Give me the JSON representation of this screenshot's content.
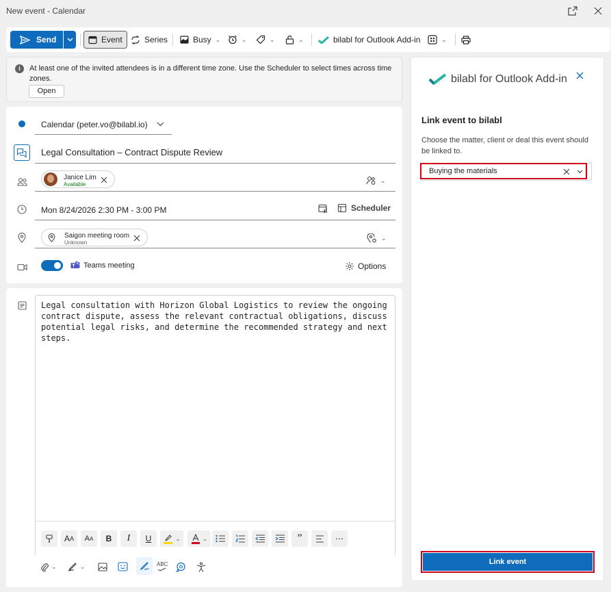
{
  "window": {
    "title": "New event - Calendar"
  },
  "toolbar": {
    "send_label": "Send",
    "event_label": "Event",
    "series_label": "Series",
    "busy_label": "Busy",
    "addin_label": "bilabl for Outlook Add-in"
  },
  "infobar": {
    "message": "At least one of the invited attendees is in a different time zone. Use the Scheduler to select times across time zones.",
    "open_label": "Open"
  },
  "form": {
    "calendar": "Calendar (peter.vo@bilabl.io)",
    "title": "Legal Consultation – Contract Dispute Review",
    "attendee": {
      "name": "Janice Lim",
      "status": "Available"
    },
    "datetime": "Mon 8/24/2026 2:30 PM - 3:00 PM",
    "scheduler_label": "Scheduler",
    "location": {
      "name": "Saigon meeting room",
      "status": "Unknown"
    },
    "teams_label": "Teams meeting",
    "teams_on": true,
    "options_label": "Options"
  },
  "body": {
    "text": "Legal consultation with Horizon Global Logistics to review the ongoing\ncontract dispute, assess the relevant contractual obligations, discuss\npotential legal risks, and determine the recommended strategy and next\nsteps."
  },
  "panel": {
    "title": "bilabl for Outlook Add-in",
    "heading": "Link event to bilabl",
    "description": "Choose the matter, client or deal this event should be linked to.",
    "selected": "Buying the materials",
    "button_label": "Link event"
  },
  "colors": {
    "accent": "#0f6cbd",
    "highlight": "#d0021b",
    "available": "#107c10"
  }
}
